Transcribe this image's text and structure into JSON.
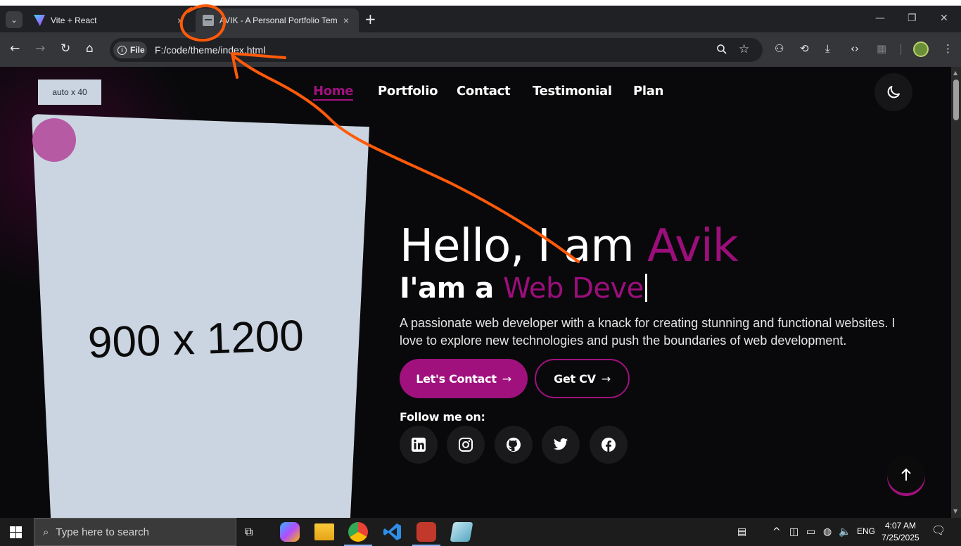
{
  "browser": {
    "tabs": [
      {
        "title": "Vite + React",
        "active": false
      },
      {
        "title": "AVIK - A Personal Portfolio Tem",
        "active": true
      }
    ],
    "new_tab": "+",
    "address": {
      "chip": "File",
      "url": "F:/code/theme/index.html"
    }
  },
  "site": {
    "logo_placeholder": "auto x 40",
    "nav": [
      "Home",
      "Portfolio",
      "Contact",
      "Testimonial",
      "Plan"
    ],
    "hero_image_placeholder": "900 x 1200",
    "heading_prefix": "Hello, I am ",
    "heading_name": "Avik",
    "role_prefix": "I'am a ",
    "role_typed": "Web Deve",
    "description": "A passionate web developer with a knack for creating stunning and functional websites. I love to explore new technologies and push the boundaries of web development.",
    "buttons": {
      "contact": "Let's Contact",
      "cv": "Get CV"
    },
    "follow_label": "Follow me on:",
    "socials": [
      "linkedin-icon",
      "instagram-icon",
      "github-icon",
      "twitter-icon",
      "facebook-icon"
    ],
    "colors": {
      "accent": "#a0117e",
      "background": "#09090b",
      "annotation": "#ff5a0a"
    }
  },
  "taskbar": {
    "search_placeholder": "Type here to search",
    "language": "ENG",
    "time": "4:07 AM",
    "date": "7/25/2025"
  }
}
